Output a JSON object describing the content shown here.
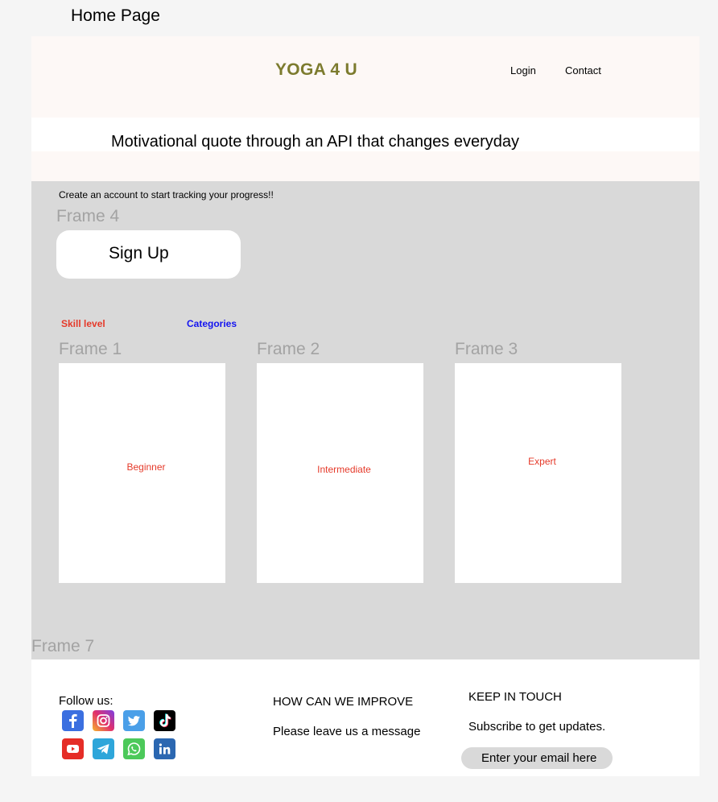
{
  "page_label": "Home Page",
  "header": {
    "logo": "YOGA 4 U",
    "nav": [
      "Login",
      "Contact"
    ]
  },
  "quote": "Motivational quote through an API that changes everyday",
  "main": {
    "cta_text": "Create an account to start tracking your progress!!",
    "frame4_label": "Frame 4",
    "signup_label": "Sign Up",
    "skill_label": "Skill level",
    "categories_label": "Categories",
    "cards": [
      {
        "frame_label": "Frame 1",
        "title": "Beginner"
      },
      {
        "frame_label": "Frame 2",
        "title": "Intermediate"
      },
      {
        "frame_label": "Frame 3",
        "title": "Expert"
      }
    ],
    "frame7_label": "Frame 7"
  },
  "footer": {
    "follow_label": "Follow us:",
    "social_icons": [
      "facebook-icon",
      "instagram-icon",
      "twitter-icon",
      "tiktok-icon",
      "youtube-icon",
      "telegram-icon",
      "whatsapp-icon",
      "linkedin-icon"
    ],
    "improve_title": "HOW CAN WE IMPROVE",
    "improve_text": "Please leave us a message",
    "keep_title": "KEEP IN TOUCH",
    "keep_text": "Subscribe to get updates.",
    "email_placeholder": "Enter your email here"
  },
  "colors": {
    "logo": "#7c7b2e",
    "skill_label": "#e53a2a",
    "categories_label": "#1414f0",
    "card_title": "#e53a2a",
    "main_bg": "#d9d9d9",
    "header_bg": "#fdf8f6"
  }
}
